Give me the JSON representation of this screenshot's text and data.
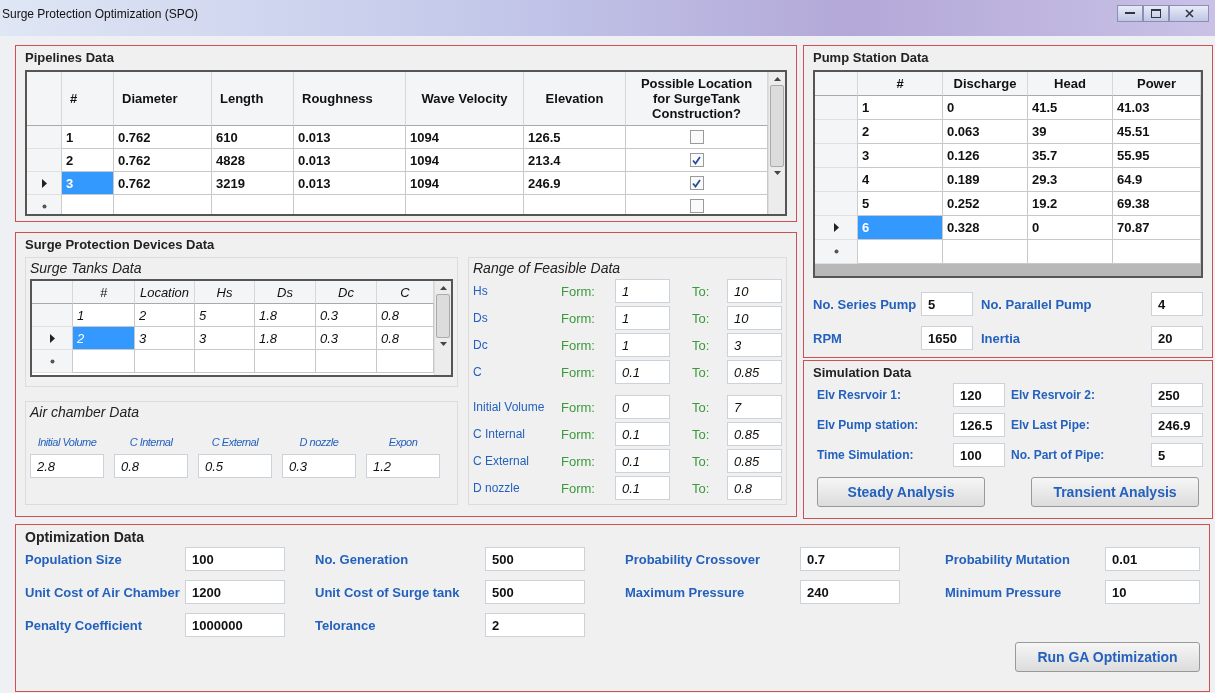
{
  "window": {
    "title": "Surge Protection Optimization (SPO)"
  },
  "pipelines": {
    "title": "Pipelines Data",
    "columns": [
      "#",
      "Diameter",
      "Length",
      "Roughness",
      "Wave Velocity",
      "Elevation",
      "Possible Location for SurgeTank Construction?"
    ],
    "rows": [
      {
        "cells": [
          "1",
          "0.762",
          "610",
          "0.013",
          "1094",
          "126.5"
        ],
        "possible_location": false,
        "selected": false
      },
      {
        "cells": [
          "2",
          "0.762",
          "4828",
          "0.013",
          "1094",
          "213.4"
        ],
        "possible_location": true,
        "selected": false
      },
      {
        "cells": [
          "3",
          "0.762",
          "3219",
          "0.013",
          "1094",
          "246.9"
        ],
        "possible_location": true,
        "selected": true
      }
    ],
    "new_row": {
      "possible_location": false
    }
  },
  "pump_station": {
    "title": "Pump Station Data",
    "columns": [
      "#",
      "Discharge",
      "Head",
      "Power"
    ],
    "rows": [
      {
        "cells": [
          "1",
          "0",
          "41.5",
          "41.03"
        ],
        "selected": false
      },
      {
        "cells": [
          "2",
          "0.063",
          "39",
          "45.51"
        ],
        "selected": false
      },
      {
        "cells": [
          "3",
          "0.126",
          "35.7",
          "55.95"
        ],
        "selected": false
      },
      {
        "cells": [
          "4",
          "0.189",
          "29.3",
          "64.9"
        ],
        "selected": false
      },
      {
        "cells": [
          "5",
          "0.252",
          "19.2",
          "69.38"
        ],
        "selected": false
      },
      {
        "cells": [
          "6",
          "0.328",
          "0",
          "70.87"
        ],
        "selected": true
      }
    ],
    "fields": [
      {
        "label": "No. Series Pump",
        "value": "5"
      },
      {
        "label": "No. Parallel Pump",
        "value": "4"
      },
      {
        "label": "RPM",
        "value": "1650"
      },
      {
        "label": "Inertia",
        "value": "20"
      }
    ]
  },
  "surge_devices": {
    "title": "Surge Protection Devices Data",
    "surge_tanks": {
      "title": "Surge Tanks Data",
      "columns": [
        "#",
        "Location",
        "Hs",
        "Ds",
        "Dc",
        "C"
      ],
      "rows": [
        {
          "cells": [
            "1",
            "2",
            "5",
            "1.8",
            "0.3",
            "0.8"
          ],
          "selected": false
        },
        {
          "cells": [
            "2",
            "3",
            "3",
            "1.8",
            "0.3",
            "0.8"
          ],
          "selected": true
        }
      ]
    },
    "air_chamber": {
      "title": "Air chamber Data",
      "fields": [
        {
          "label": "Initial Volume",
          "value": "2.8"
        },
        {
          "label": "C Internal",
          "value": "0.8"
        },
        {
          "label": "C External",
          "value": "0.5"
        },
        {
          "label": "D nozzle",
          "value": "0.3"
        },
        {
          "label": "Expon",
          "value": "1.2"
        }
      ]
    },
    "feasible_range": {
      "title": "Range of Feasible Data",
      "rows": [
        {
          "label": "Hs",
          "from_label": "Form:",
          "from": "1",
          "to_label": "To:",
          "to": "10"
        },
        {
          "label": "Ds",
          "from_label": "Form:",
          "from": "1",
          "to_label": "To:",
          "to": "10"
        },
        {
          "label": "Dc",
          "from_label": "Form:",
          "from": "1",
          "to_label": "To:",
          "to": "3"
        },
        {
          "label": "C",
          "from_label": "Form:",
          "from": "0.1",
          "to_label": "To:",
          "to": "0.85"
        },
        {
          "label": "Initial Volume",
          "from_label": "Form:",
          "from": "0",
          "to_label": "To:",
          "to": "7"
        },
        {
          "label": "C Internal",
          "from_label": "Form:",
          "from": "0.1",
          "to_label": "To:",
          "to": "0.85"
        },
        {
          "label": "C External",
          "from_label": "Form:",
          "from": "0.1",
          "to_label": "To:",
          "to": "0.85"
        },
        {
          "label": "D nozzle",
          "from_label": "Form:",
          "from": "0.1",
          "to_label": "To:",
          "to": "0.8"
        }
      ]
    }
  },
  "simulation": {
    "title": "Simulation Data",
    "fields": [
      {
        "label": "Elv Resrvoir 1:",
        "value": "120"
      },
      {
        "label": "Elv Resrvoir 2:",
        "value": "250"
      },
      {
        "label": "Elv Pump station:",
        "value": "126.5"
      },
      {
        "label": "Elv Last Pipe:",
        "value": "246.9"
      },
      {
        "label": "Time Simulation:",
        "value": "100"
      },
      {
        "label": "No. Part of Pipe:",
        "value": "5"
      }
    ],
    "buttons": [
      "Steady Analysis",
      "Transient Analysis"
    ]
  },
  "optimization": {
    "title": "Optimization Data",
    "fields": [
      {
        "label": "Population Size",
        "value": "100"
      },
      {
        "label": "No. Generation",
        "value": "500"
      },
      {
        "label": "Probability Crossover",
        "value": "0.7"
      },
      {
        "label": "Probability Mutation",
        "value": "0.01"
      },
      {
        "label": "Unit Cost of Air Chamber",
        "value": "1200"
      },
      {
        "label": "Unit Cost of Surge tank",
        "value": "500"
      },
      {
        "label": "Maximum Pressure",
        "value": "240"
      },
      {
        "label": "Minimum Pressure",
        "value": "10"
      },
      {
        "label": "Penalty Coefficient",
        "value": "1000000"
      },
      {
        "label": "Telorance",
        "value": "2"
      }
    ],
    "button": "Run GA Optimization"
  }
}
